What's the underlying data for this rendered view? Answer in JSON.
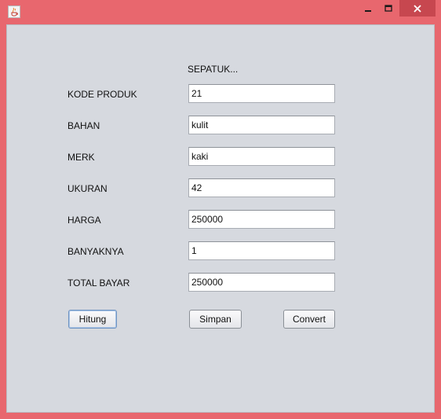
{
  "window": {
    "title": ""
  },
  "form": {
    "heading": "SEPATUK...",
    "fields": [
      {
        "label": "KODE PRODUK",
        "value": "21"
      },
      {
        "label": "BAHAN",
        "value": "kulit"
      },
      {
        "label": "MERK",
        "value": "kaki"
      },
      {
        "label": "UKURAN",
        "value": "42"
      },
      {
        "label": "HARGA",
        "value": "250000"
      },
      {
        "label": "BANYAKNYA",
        "value": "1"
      },
      {
        "label": "TOTAL BAYAR",
        "value": "250000"
      }
    ]
  },
  "buttons": {
    "hitung": "Hitung",
    "simpan": "Simpan",
    "convert": "Convert"
  },
  "colors": {
    "frame": "#e8676e",
    "close_button": "#c7474f",
    "panel": "#d6d9df"
  },
  "icons": {
    "app": "java-coffee-cup-icon",
    "minimize": "minimize-icon",
    "maximize": "maximize-icon",
    "close": "close-icon"
  }
}
